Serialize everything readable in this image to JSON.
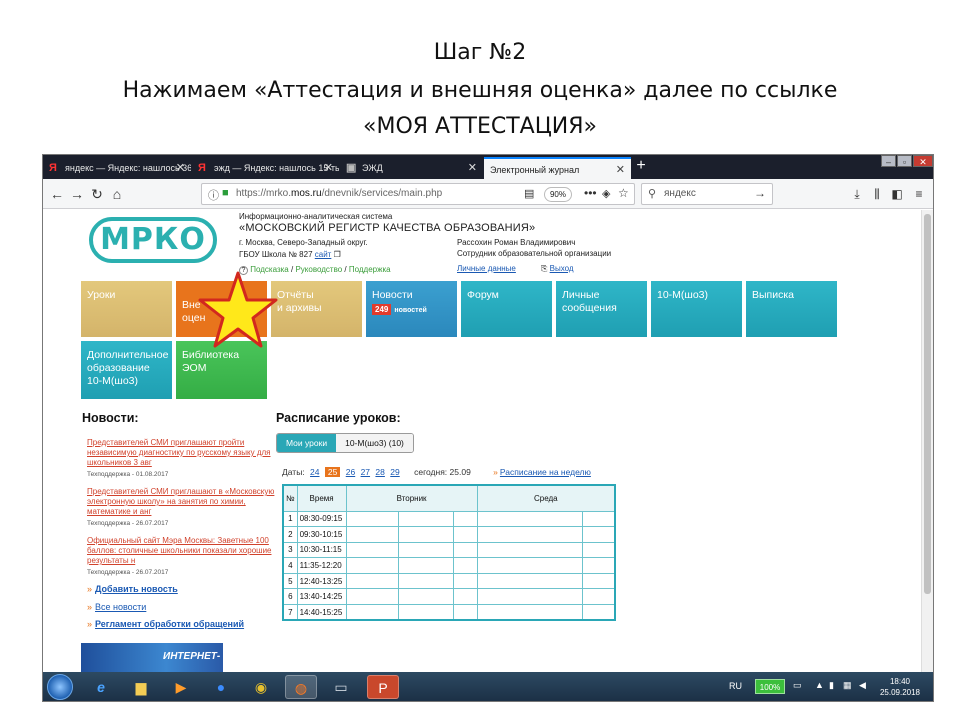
{
  "slide": {
    "line1": "Шаг №2",
    "line2": "Нажимаем «Аттестация и внешняя оценка» далее по ссылке",
    "line3": "«МОЯ АТТЕСТАЦИЯ»"
  },
  "browser": {
    "tabs": [
      {
        "label": "яндекс — Яндекс: нашлось 36",
        "icon": "yandex-icon"
      },
      {
        "label": "эжд — Яндекс: нашлось 15 ты",
        "icon": "yandex-icon"
      },
      {
        "label": "ЭЖД",
        "icon": "page-icon"
      },
      {
        "label": "Электронный журнал",
        "icon": ""
      }
    ],
    "new_tab": "+",
    "url_prefix": "https://mrko.",
    "url_domain": "mos.ru",
    "url_suffix": "/dnevnik/services/main.php",
    "zoom": "90%",
    "search_placeholder": "яндекс",
    "accent_color": "#0a84ff"
  },
  "site": {
    "logo": "МРКО",
    "system_caption": "Информационно-аналитическая система",
    "system_name": "«МОСКОВСКИЙ РЕГИСТР КАЧЕСТВА ОБРАЗОВАНИЯ»",
    "city": "г. Москва, Северо-Западный округ.",
    "school": "ГБОУ Школа № 827",
    "school_link": "сайт",
    "help_links": [
      "Подсказка",
      "Руководство",
      "Поддержка"
    ],
    "user_name": "Рассохин Роман Владимирович",
    "user_role": "Сотрудник образовательной организации",
    "personal_link": "Личные данные",
    "logout_link": "Выход"
  },
  "tiles": {
    "uroki": "Уроки",
    "attest_1": "Вне",
    "attest_2": "оцен",
    "reports_1": "Отчёты",
    "reports_2": "и архивы",
    "news": "Новости",
    "news_count": "249",
    "news_count_label": "новостей",
    "forum": "Форум",
    "messages_1": "Личные",
    "messages_2": "сообщения",
    "class": "10-М(шо3)",
    "extract": "Выписка",
    "extra_1": "Дополнительное",
    "extra_2": "образование",
    "extra_3": "10-М(шо3)",
    "library_1": "Библиотека",
    "library_2": "ЭОМ"
  },
  "news": {
    "title": "Новости:",
    "items": [
      {
        "text": "Представителей СМИ приглашают пройти независимую диагностику по русскому языку для школьников 3 авг",
        "meta": "Техподдержка - 01.08.2017"
      },
      {
        "text": "Представителей СМИ приглашают в «Московскую электронную школу» на занятия по химии, математике и анг",
        "meta": "Техподдержка - 26.07.2017"
      },
      {
        "text": "Официальный сайт Мэра Москвы: Заветные 100 баллов: столичные школьники показали хорошие результаты н",
        "meta": "Техподдержка - 26.07.2017"
      }
    ],
    "links": [
      "Добавить новость",
      "Все новости",
      "Регламент обработки обращений"
    ],
    "banner": "ИНТЕРНЕТ-"
  },
  "schedule": {
    "title": "Расписание уроков:",
    "toggle_mine": "Мои уроки",
    "toggle_class": "10-М(шо3) (10)",
    "dates_label": "Даты:",
    "dates": [
      "24",
      "25",
      "26",
      "27",
      "28",
      "29"
    ],
    "today": "сегодня: 25.09",
    "week_link": "Расписание на неделю",
    "headers": [
      "№",
      "Время",
      "Вторник",
      "Среда"
    ],
    "rows": [
      {
        "num": "1",
        "time": "08:30-09:15"
      },
      {
        "num": "2",
        "time": "09:30-10:15"
      },
      {
        "num": "3",
        "time": "10:30-11:15"
      },
      {
        "num": "4",
        "time": "11:35-12:20"
      },
      {
        "num": "5",
        "time": "12:40-13:25"
      },
      {
        "num": "6",
        "time": "13:40-14:25"
      },
      {
        "num": "7",
        "time": "14:40-15:25"
      }
    ]
  },
  "taskbar": {
    "lang": "RU",
    "battery": "100%",
    "time": "18:40",
    "date": "25.09.2018"
  }
}
